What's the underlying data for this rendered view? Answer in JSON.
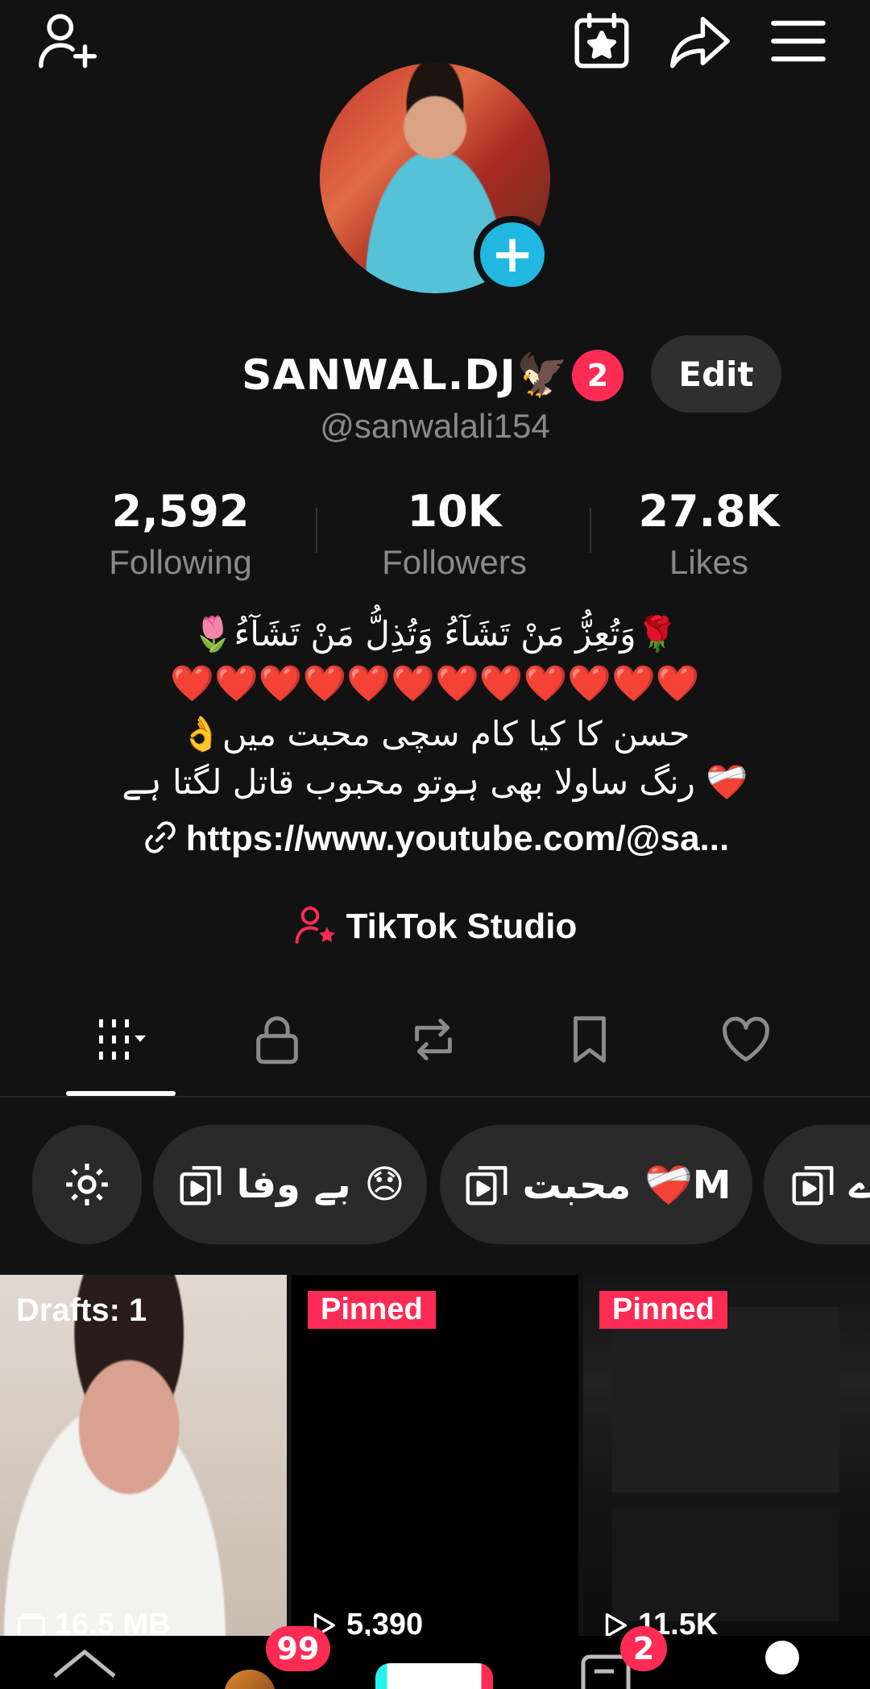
{
  "profile": {
    "display_name": "SANWAL.DJ🦅",
    "notification_count": "2",
    "edit_label": "Edit",
    "handle": "@sanwalali154"
  },
  "stats": {
    "following": {
      "value": "2,592",
      "label": "Following"
    },
    "followers": {
      "value": "10K",
      "label": "Followers"
    },
    "likes": {
      "value": "27.8K",
      "label": "Likes"
    }
  },
  "bio": {
    "line1": "🌷وَتُعِزُّ مَنْ تَشَآءُ وَتُذِلُّ مَنْ تَشَآءُ🌹",
    "line2": "❤️❤️❤️❤️❤️❤️❤️❤️❤️❤️❤️❤️",
    "line3": "👌حسن کا کیا کام سچی محبت میں",
    "line4": "رنگ ساولا بھی ہوتو محبوب قاتل لگتا ہے ❤️‍🩹",
    "link": "https://www.youtube.com/@sa..."
  },
  "studio_label": "TikTok Studio",
  "tabs": [
    "videos",
    "private",
    "reposts",
    "favorites",
    "liked"
  ],
  "collections": [
    {
      "label": "بے وفا 😞"
    },
    {
      "label": "محبت ❤️‍🩹M"
    },
    {
      "label": "ے"
    }
  ],
  "grid": [
    {
      "label": "Drafts: 1",
      "stat": "16.5 MB"
    },
    {
      "label": "Pinned",
      "stat": "5,390"
    },
    {
      "label": "Pinned",
      "stat": "11.5K"
    }
  ],
  "nav": {
    "inbox_badge": "99",
    "messages_badge": "2"
  },
  "colors": {
    "background": "#121212",
    "accent": "#fe2c55",
    "avatar_add": "#20b8e0"
  }
}
